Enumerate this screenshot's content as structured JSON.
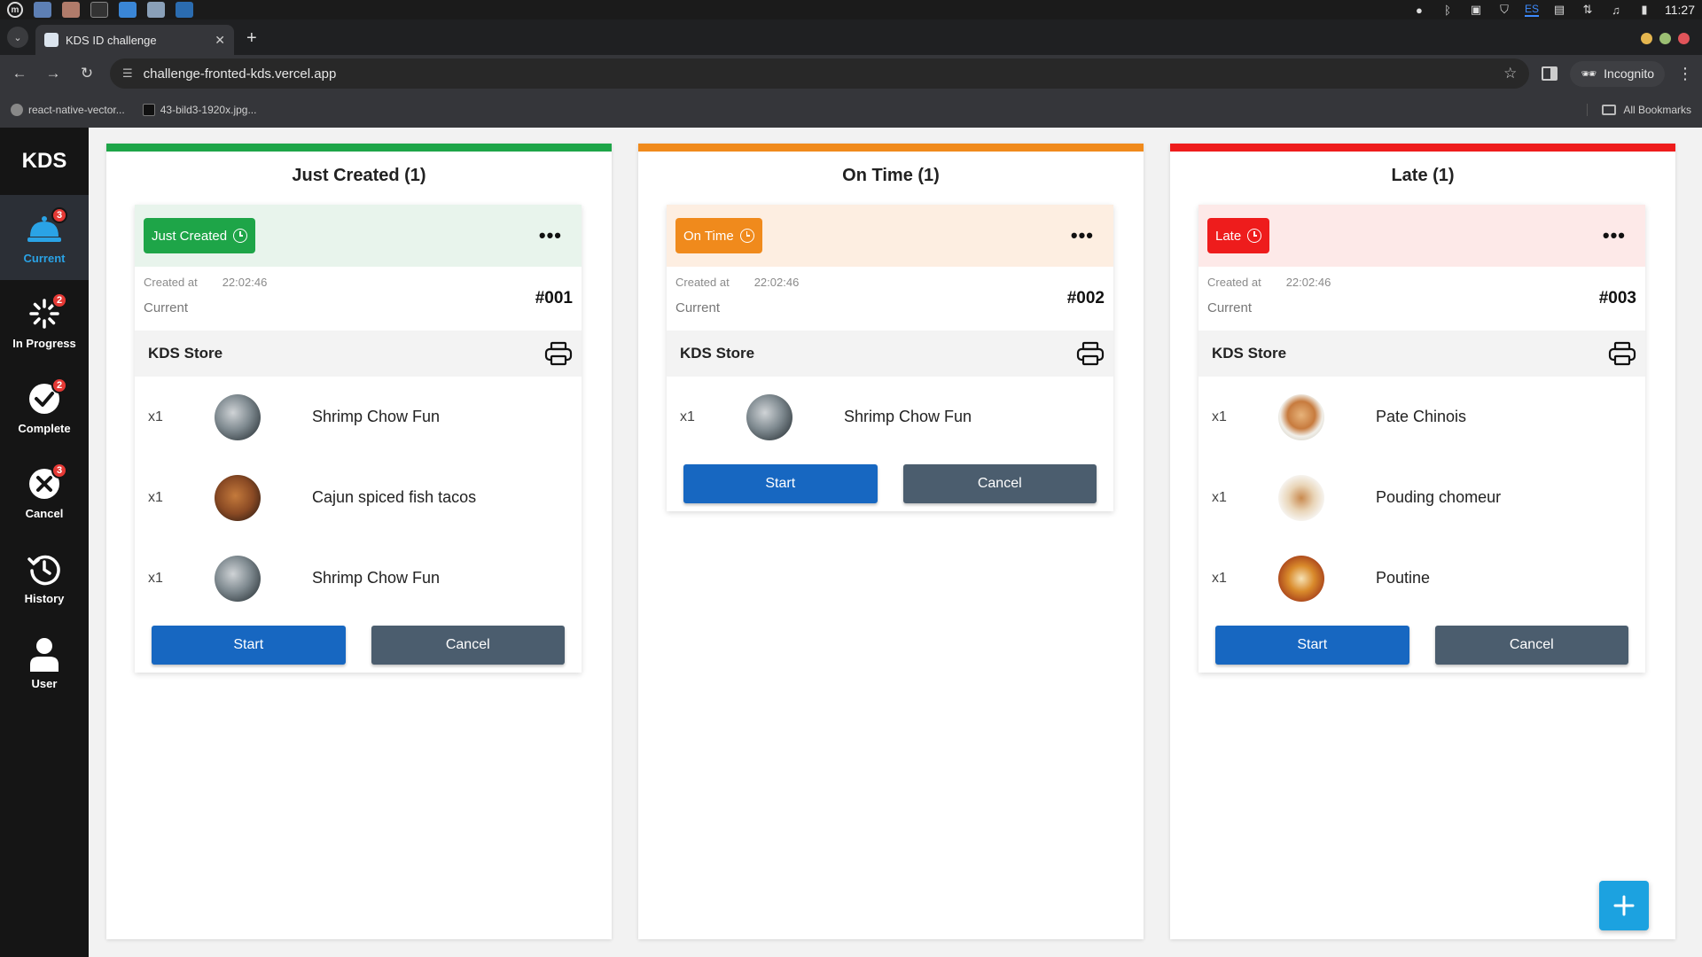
{
  "os": {
    "clock": "11:27",
    "lang": "ES"
  },
  "browser": {
    "tab_title": "KDS ID challenge",
    "url": "challenge-fronted-kds.vercel.app",
    "incognito_label": "Incognito",
    "bookmarks": [
      "react-native-vector...",
      "43-bild3-1920x.jpg..."
    ],
    "all_bookmarks": "All Bookmarks"
  },
  "sidebar": {
    "brand": "KDS",
    "items": [
      {
        "label": "Current",
        "badge": "3"
      },
      {
        "label": "In Progress",
        "badge": "2"
      },
      {
        "label": "Complete",
        "badge": "2"
      },
      {
        "label": "Cancel",
        "badge": "3"
      },
      {
        "label": "History"
      },
      {
        "label": "User"
      }
    ]
  },
  "colors": {
    "just_created": "#1ea548",
    "on_time": "#f08a1c",
    "late": "#ee1c1c",
    "start_btn": "#1767c1",
    "cancel_btn": "#4b5d6e",
    "active_nav": "#2aa3e6"
  },
  "columns": [
    {
      "title": "Just Created (1)",
      "card": {
        "status": "Just Created",
        "created_label": "Created at",
        "created_time": "22:02:46",
        "state": "Current",
        "order_no": "#001",
        "store": "KDS Store",
        "items": [
          {
            "qty": "x1",
            "name": "Shrimp Chow Fun"
          },
          {
            "qty": "x1",
            "name": "Cajun spiced fish tacos"
          },
          {
            "qty": "x1",
            "name": "Shrimp Chow Fun"
          }
        ],
        "start": "Start",
        "cancel": "Cancel"
      }
    },
    {
      "title": "On Time (1)",
      "card": {
        "status": "On Time",
        "created_label": "Created at",
        "created_time": "22:02:46",
        "state": "Current",
        "order_no": "#002",
        "store": "KDS Store",
        "items": [
          {
            "qty": "x1",
            "name": "Shrimp Chow Fun"
          }
        ],
        "start": "Start",
        "cancel": "Cancel"
      }
    },
    {
      "title": "Late (1)",
      "card": {
        "status": "Late",
        "created_label": "Created at",
        "created_time": "22:02:46",
        "state": "Current",
        "order_no": "#003",
        "store": "KDS Store",
        "items": [
          {
            "qty": "x1",
            "name": "Pate Chinois"
          },
          {
            "qty": "x1",
            "name": "Pouding chomeur"
          },
          {
            "qty": "x1",
            "name": "Poutine"
          }
        ],
        "start": "Start",
        "cancel": "Cancel"
      }
    }
  ],
  "fab": {
    "icon": "plus-icon"
  }
}
